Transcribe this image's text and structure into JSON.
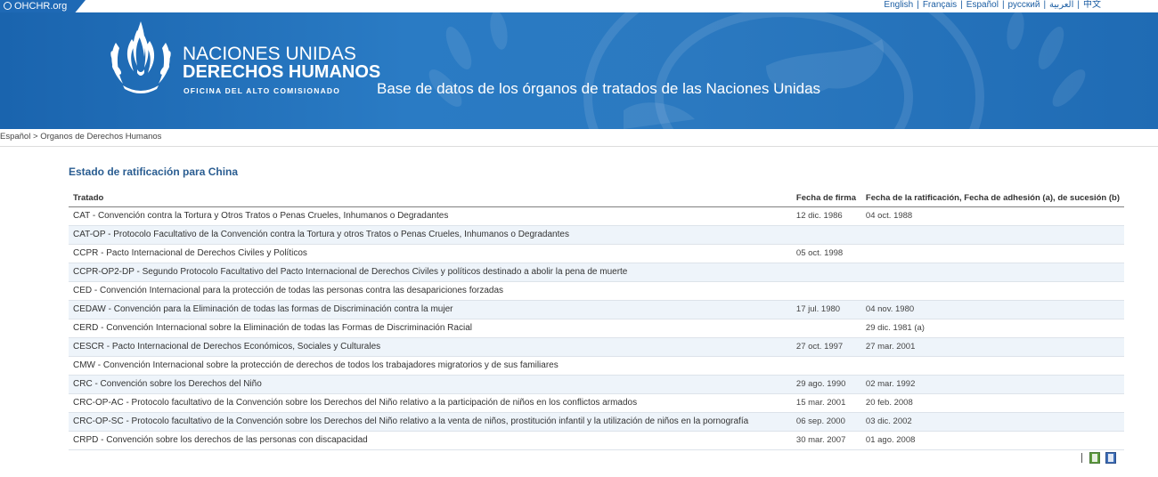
{
  "top": {
    "site": "OHCHR.org",
    "languages": [
      "English",
      "Français",
      "Español",
      "русский",
      "العربية",
      "中文"
    ]
  },
  "banner": {
    "org_line1": "NACIONES UNIDAS",
    "org_line2": "DERECHOS HUMANOS",
    "org_line3": "OFICINA DEL ALTO COMISIONADO",
    "db_title": "Base de datos de los órganos de tratados de las Naciones Unidas",
    "colors": {
      "banner_blue": "#1f6bb4",
      "link_blue": "#1c5ea3",
      "title_blue": "#2a5d91"
    }
  },
  "breadcrumb": {
    "home": "Español",
    "separator": ">",
    "current": "Organos de Derechos Humanos"
  },
  "main": {
    "title": "Estado de ratificación para China",
    "columns": [
      "Tratado",
      "Fecha de firma",
      "Fecha de la ratificación, Fecha de adhesión (a), de sucesión (b)"
    ],
    "rows": [
      {
        "treaty": "CAT - Convención contra la Tortura y Otros Tratos o Penas Crueles, Inhumanos o Degradantes",
        "signed": "12 dic. 1986",
        "ratified": "04 oct. 1988"
      },
      {
        "treaty": "CAT-OP - Protocolo Facultativo de la Convención contra la Tortura y otros Tratos o Penas Crueles, Inhumanos o Degradantes",
        "signed": "",
        "ratified": ""
      },
      {
        "treaty": "CCPR - Pacto Internacional de Derechos Civiles y Políticos",
        "signed": "05 oct. 1998",
        "ratified": ""
      },
      {
        "treaty": "CCPR-OP2-DP - Segundo Protocolo Facultativo del Pacto Internacional de Derechos Civiles y políticos destinado a abolir la pena de muerte",
        "signed": "",
        "ratified": ""
      },
      {
        "treaty": "CED - Convención Internacional para la protección de todas las personas contra las desapariciones forzadas",
        "signed": "",
        "ratified": ""
      },
      {
        "treaty": "CEDAW - Convención para la Eliminación de todas las formas de Discriminación contra la mujer",
        "signed": "17 jul. 1980",
        "ratified": "04 nov. 1980"
      },
      {
        "treaty": "CERD - Convención Internacional sobre la Eliminación de todas las Formas de Discriminación Racial",
        "signed": "",
        "ratified": "29 dic. 1981 (a)"
      },
      {
        "treaty": "CESCR - Pacto Internacional de Derechos Económicos, Sociales y Culturales",
        "signed": "27 oct. 1997",
        "ratified": "27 mar. 2001"
      },
      {
        "treaty": "CMW - Convención Internacional sobre la protección de derechos de todos los trabajadores migratorios y de sus familiares",
        "signed": "",
        "ratified": ""
      },
      {
        "treaty": "CRC - Convención sobre los Derechos del Niño",
        "signed": "29 ago. 1990",
        "ratified": "02 mar. 1992"
      },
      {
        "treaty": "CRC-OP-AC - Protocolo facultativo de la Convención sobre los Derechos del Niño relativo a la participación de niños en los conflictos armados",
        "signed": "15 mar. 2001",
        "ratified": "20 feb. 2008"
      },
      {
        "treaty": "CRC-OP-SC - Protocolo facultativo de la Convención sobre los Derechos del Niño relativo a la venta de niños, prostitución infantil y la utilización de niños en la pornografía",
        "signed": "06 sep. 2000",
        "ratified": "03 dic. 2002"
      },
      {
        "treaty": "CRPD - Convención sobre los derechos de las personas con discapacidad",
        "signed": "30 mar. 2007",
        "ratified": "01 ago. 2008"
      }
    ]
  },
  "export": {
    "icons": [
      "excel-export-icon",
      "word-export-icon"
    ]
  }
}
